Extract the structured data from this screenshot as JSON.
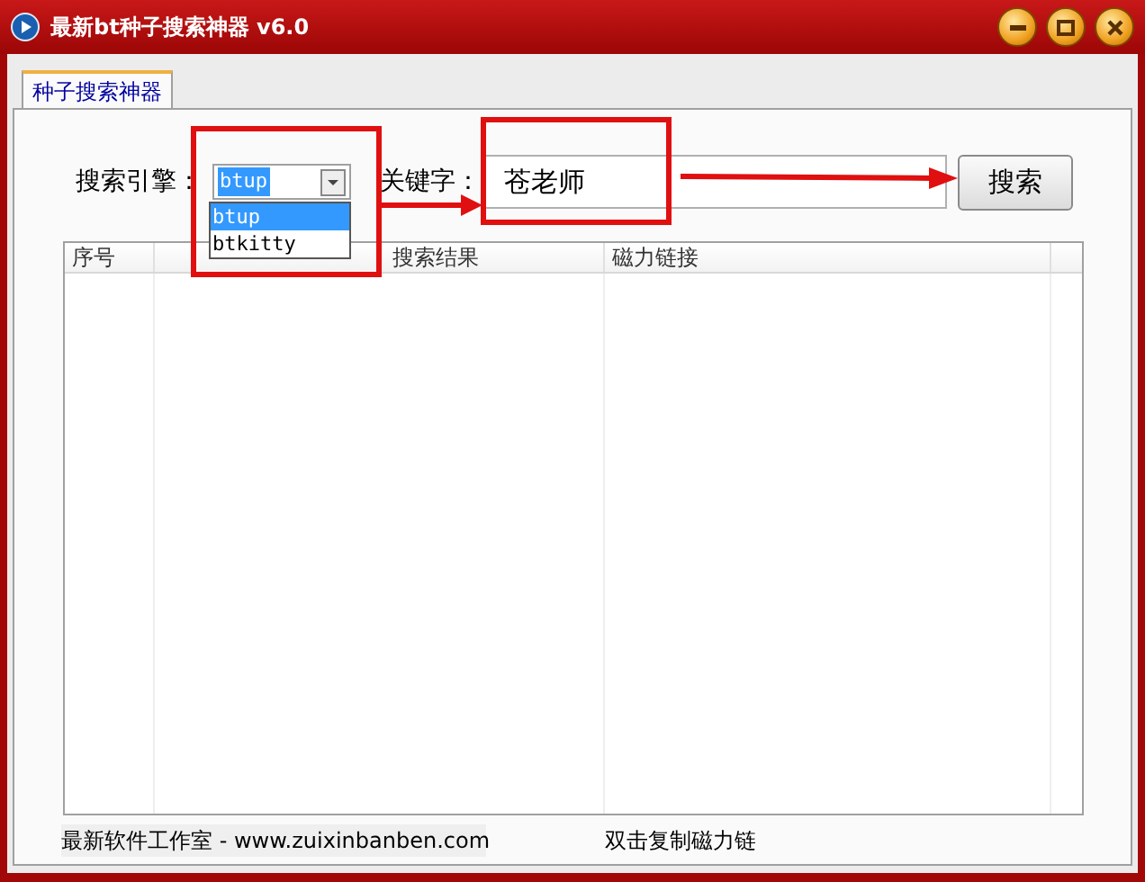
{
  "window": {
    "title": "最新bt种子搜索神器 v6.0"
  },
  "tabs": [
    {
      "label": "种子搜索神器",
      "selected": true
    }
  ],
  "search_engine": {
    "label": "搜索引擎：",
    "value": "btup",
    "expanded": true,
    "options": [
      {
        "label": "btup",
        "selected": true
      },
      {
        "label": "btkitty",
        "selected": false
      }
    ]
  },
  "keyword": {
    "label": "关键字：",
    "value": "苍老师"
  },
  "search_button": "搜索",
  "table": {
    "columns": [
      "序号",
      "搜索结果",
      "磁力链接"
    ]
  },
  "status_bar": [
    "最新软件工作室 - www.zuixinbanben.com",
    "双击复制磁力链"
  ]
}
